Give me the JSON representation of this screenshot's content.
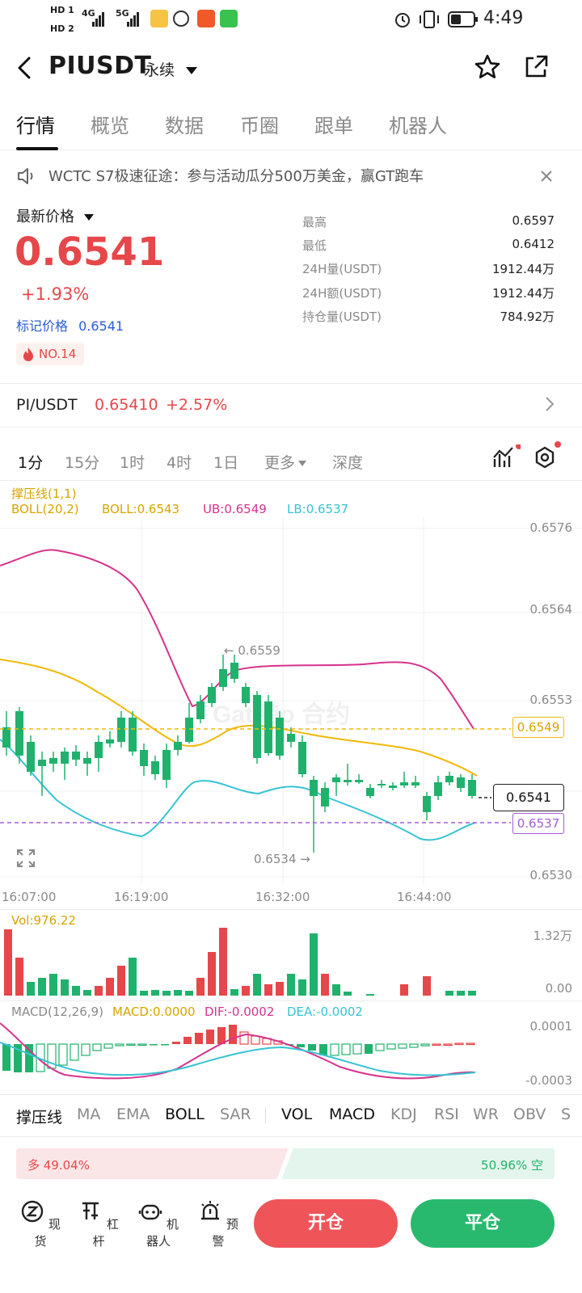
{
  "status_bar": {
    "hd1": "HD 1",
    "hd2": "HD 2",
    "net1": "4G",
    "net2": "5G",
    "time": "4:49"
  },
  "header": {
    "pair": "PIUSDT",
    "contract_type": "永续"
  },
  "tabs": [
    "行情",
    "概览",
    "数据",
    "币圈",
    "跟单",
    "机器人"
  ],
  "notice": {
    "text": "WCTC S7极速征途：参与活动瓜分500万美金，赢GT跑车"
  },
  "price": {
    "label": "最新价格",
    "last": "0.6541",
    "change": "+1.93%",
    "mark_label": "标记价格",
    "mark_value": "0.6541",
    "rank": "NO.14"
  },
  "stats": [
    {
      "label": "最高",
      "value": "0.6597"
    },
    {
      "label": "最低",
      "value": "0.6412"
    },
    {
      "label": "24H量(USDT)",
      "value": "1912.44万"
    },
    {
      "label": "24H额(USDT)",
      "value": "1912.44万"
    },
    {
      "label": "持仓量(USDT)",
      "value": "784.92万"
    }
  ],
  "spot": {
    "pair": "PI/USDT",
    "price": "0.65410",
    "change": "+2.57%"
  },
  "intervals": [
    "1分",
    "15分",
    "1时",
    "4时",
    "1日",
    "更多",
    "深度"
  ],
  "indicators_header": {
    "line1": "撑压线(1,1)",
    "boll": "BOLL(20,2)",
    "boll_val": "BOLL:0.6543",
    "ub": "UB:0.6549",
    "lb": "LB:0.6537"
  },
  "price_axis": [
    "0.6576",
    "0.6564",
    "0.6553",
    "0.6530"
  ],
  "price_tags": {
    "ub_tag": "0.6549",
    "current_tag": "0.6541",
    "lb_tag": "0.6537",
    "high_marker": "← 0.6559",
    "low_marker": "0.6534 →"
  },
  "time_axis": [
    "16:07:00",
    "16:19:00",
    "16:32:00",
    "16:44:00"
  ],
  "watermark": "Gate.io 合约",
  "volume": {
    "label": "Vol:976.22",
    "axis_top": "1.32万",
    "axis_bottom": "0.00"
  },
  "macd": {
    "label": "MACD(12,26,9)",
    "macd": "MACD:0.0000",
    "dif": "DIF:-0.0002",
    "dea": "DEA:-0.0002",
    "axis_top": "0.0001",
    "axis_bottom": "-0.0003"
  },
  "bottom_indicators": [
    "撑压线",
    "MA",
    "EMA",
    "BOLL",
    "SAR",
    "VOL",
    "MACD",
    "KDJ",
    "RSI",
    "WR",
    "OBV",
    "S"
  ],
  "ratio": {
    "long_label": "多 49.04%",
    "short_label": "50.96% 空",
    "long_fraction": 0.4904
  },
  "nav": [
    {
      "label": "现货",
      "icon": "spot-icon"
    },
    {
      "label": "杠杆",
      "icon": "leverage-icon"
    },
    {
      "label": "机器人",
      "icon": "robot-icon"
    },
    {
      "label": "预警",
      "icon": "alarm-icon"
    }
  ],
  "buttons": {
    "open": "开仓",
    "close": "平仓"
  },
  "colors": {
    "up": "#e6474a",
    "down": "#20b26c",
    "boll_mid": "#f0b90b",
    "boll_ub": "#d6338b",
    "boll_lb": "#37c3d3"
  }
}
